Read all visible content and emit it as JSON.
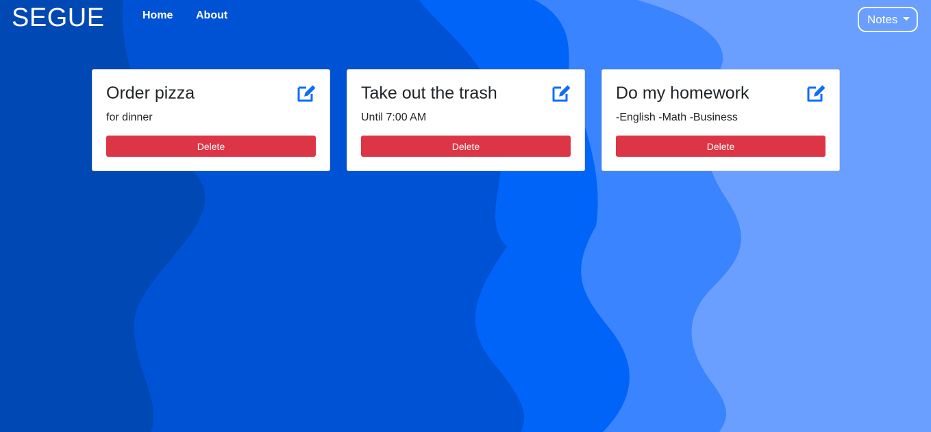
{
  "navbar": {
    "brand": "SEGUE",
    "links": [
      {
        "label": "Home"
      },
      {
        "label": "About"
      }
    ],
    "dropdown_label": "Notes"
  },
  "notes": [
    {
      "title": "Order pizza",
      "text": "for dinner",
      "delete_label": "Delete"
    },
    {
      "title": "Take out the trash",
      "text": "Until 7:00 AM",
      "delete_label": "Delete"
    },
    {
      "title": "Do my homework",
      "text": "-English -Math -Business",
      "delete_label": "Delete"
    }
  ],
  "colors": {
    "edit_icon": "#0d6efd",
    "delete_button": "#dc3545",
    "background_layers": [
      "#0048b4",
      "#0052d4",
      "#0064f8",
      "#3a84ff",
      "#6a9eff"
    ]
  },
  "icons": {
    "edit": "edit-square-pencil-icon",
    "dropdown": "caret-down-icon"
  }
}
